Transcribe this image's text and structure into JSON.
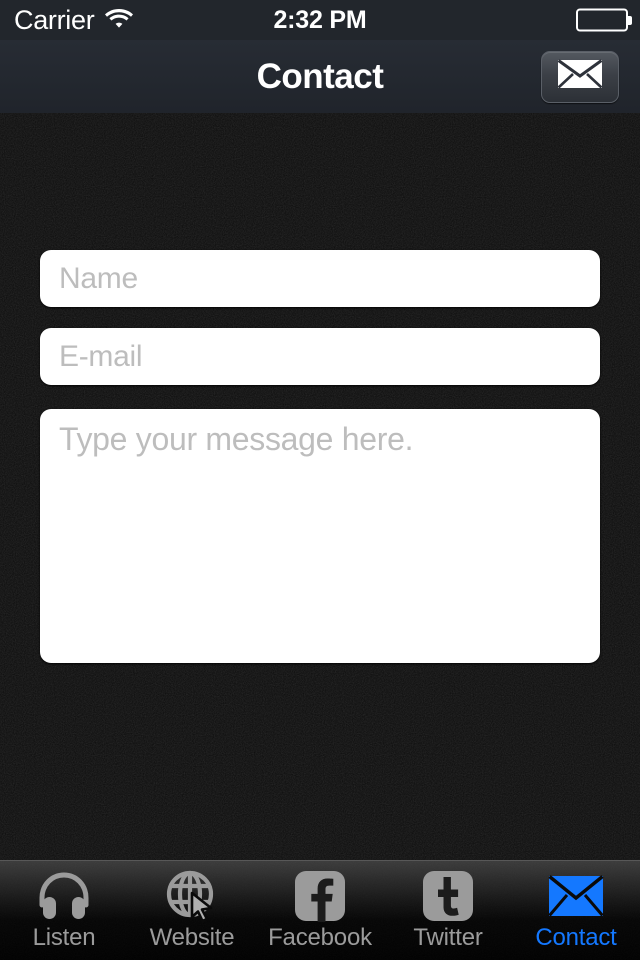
{
  "status_bar": {
    "carrier": "Carrier",
    "wifi_icon": "wifi-icon",
    "time": "2:32 PM",
    "battery_icon": "battery-full-icon"
  },
  "nav_bar": {
    "title": "Contact",
    "send_button": {
      "name": "send-message-button",
      "icon": "envelope-icon"
    }
  },
  "form": {
    "name_field": {
      "placeholder": "Name",
      "value": ""
    },
    "email_field": {
      "placeholder": "E-mail",
      "value": ""
    },
    "message_field": {
      "placeholder": "Type your message here.",
      "value": ""
    }
  },
  "tab_bar": {
    "active_tab": "Contact",
    "active_color": "#1478ff",
    "inactive_color": "#9b9b9b",
    "items": [
      {
        "label": "Listen",
        "icon": "headphones-icon",
        "active": false
      },
      {
        "label": "Website",
        "icon": "globe-cursor-icon",
        "active": false
      },
      {
        "label": "Facebook",
        "icon": "facebook-icon",
        "active": false
      },
      {
        "label": "Twitter",
        "icon": "twitter-icon",
        "active": false
      },
      {
        "label": "Contact",
        "icon": "envelope-icon",
        "active": true
      }
    ]
  },
  "theme": {
    "background": "#0b0b0b",
    "nav_background": "#272c34",
    "field_background": "#ffffff",
    "placeholder_color": "#bdbdbd"
  }
}
